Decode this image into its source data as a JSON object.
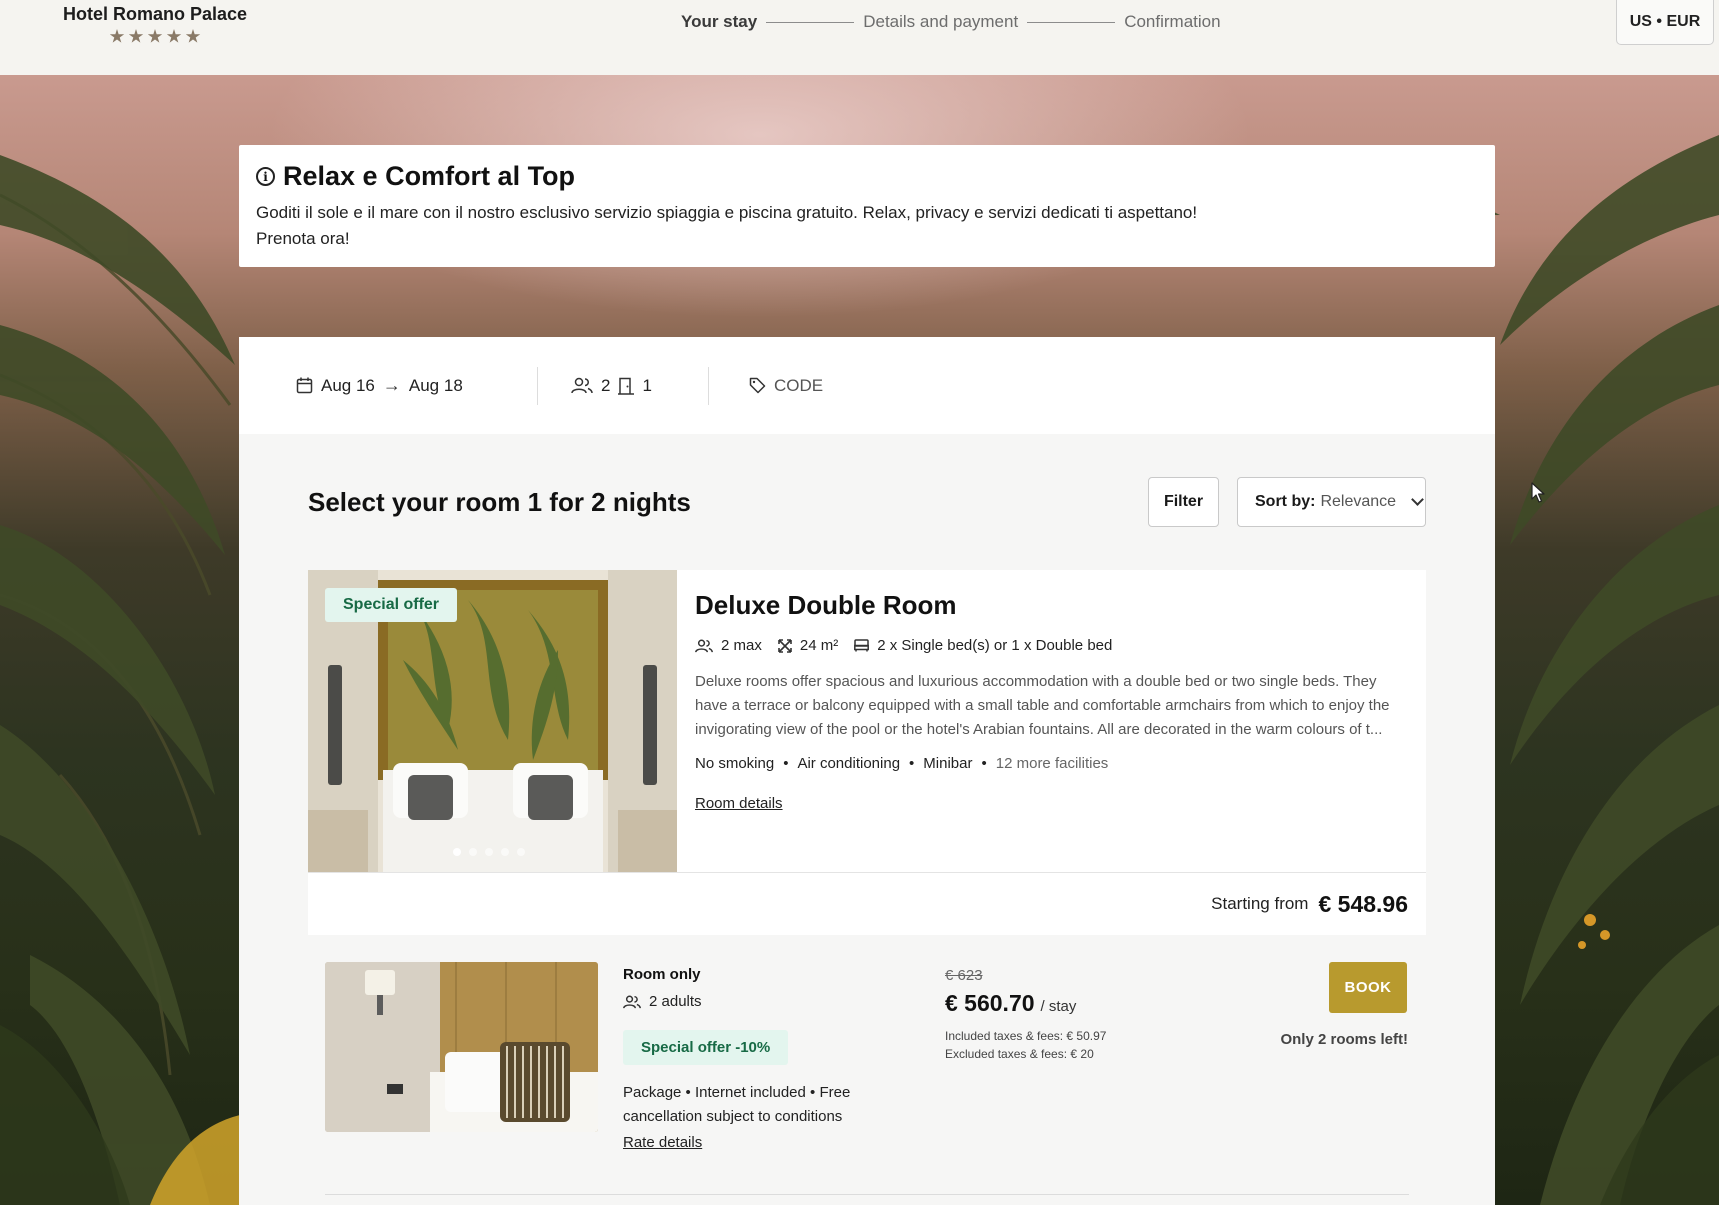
{
  "hotel": {
    "name": "Hotel Romano Palace",
    "stars": 5
  },
  "steps": [
    {
      "label": "Your stay",
      "active": true
    },
    {
      "label": "Details and payment",
      "active": false
    },
    {
      "label": "Confirmation",
      "active": false
    }
  ],
  "locale": {
    "label": "US • EUR"
  },
  "promo": {
    "title": "Relax e Comfort al Top",
    "text": "Goditi il sole e il mare con il nostro esclusivo servizio spiaggia e piscina gratuito. Relax, privacy e servizi dedicati ti aspettano! Prenota ora!"
  },
  "search": {
    "date_from": "Aug 16",
    "date_to": "Aug 18",
    "guests": "2",
    "rooms": "1",
    "code_placeholder": "CODE"
  },
  "results": {
    "title": "Select your room 1 for 2 nights",
    "filter_label": "Filter",
    "sort_label": "Sort by:",
    "sort_value": "Relevance"
  },
  "room": {
    "badge": "Special offer",
    "name": "Deluxe Double Room",
    "max_guests": "2 max",
    "size": "24 m²",
    "beds": "2 x Single bed(s) or 1 x Double bed",
    "description": "Deluxe rooms offer spacious and luxurious accommodation with a double bed or two single beds. They have a terrace or balcony equipped with a small table and comfortable armchairs from which to enjoy the invigorating view of the pool or the hotel's Arabian fountains. All are decorated in the warm colours of t...",
    "amenities": [
      "No smoking",
      "Air conditioning",
      "Minibar"
    ],
    "more_facilities": "12 more facilities",
    "details_link": "Room details",
    "image_count": 5,
    "active_image": 1,
    "starting_label": "Starting from",
    "starting_price": "€ 548.96"
  },
  "rate": {
    "name": "Room only",
    "adults": "2 adults",
    "badge": "Special offer -10%",
    "perks": "Package • Internet included • Free cancellation subject to conditions",
    "details_link": "Rate details",
    "old_price": "€ 623",
    "price": "€ 560.70",
    "per": "/ stay",
    "included_taxes": "Included taxes & fees: € 50.97",
    "excluded_taxes": "Excluded taxes & fees: € 20",
    "book_label": "BOOK",
    "availability": "Only 2 rooms left!"
  },
  "colors": {
    "accent_gold": "#b89a2e",
    "offer_bg": "#e3f5ee",
    "offer_text": "#176a45",
    "star": "#8a7a67"
  }
}
